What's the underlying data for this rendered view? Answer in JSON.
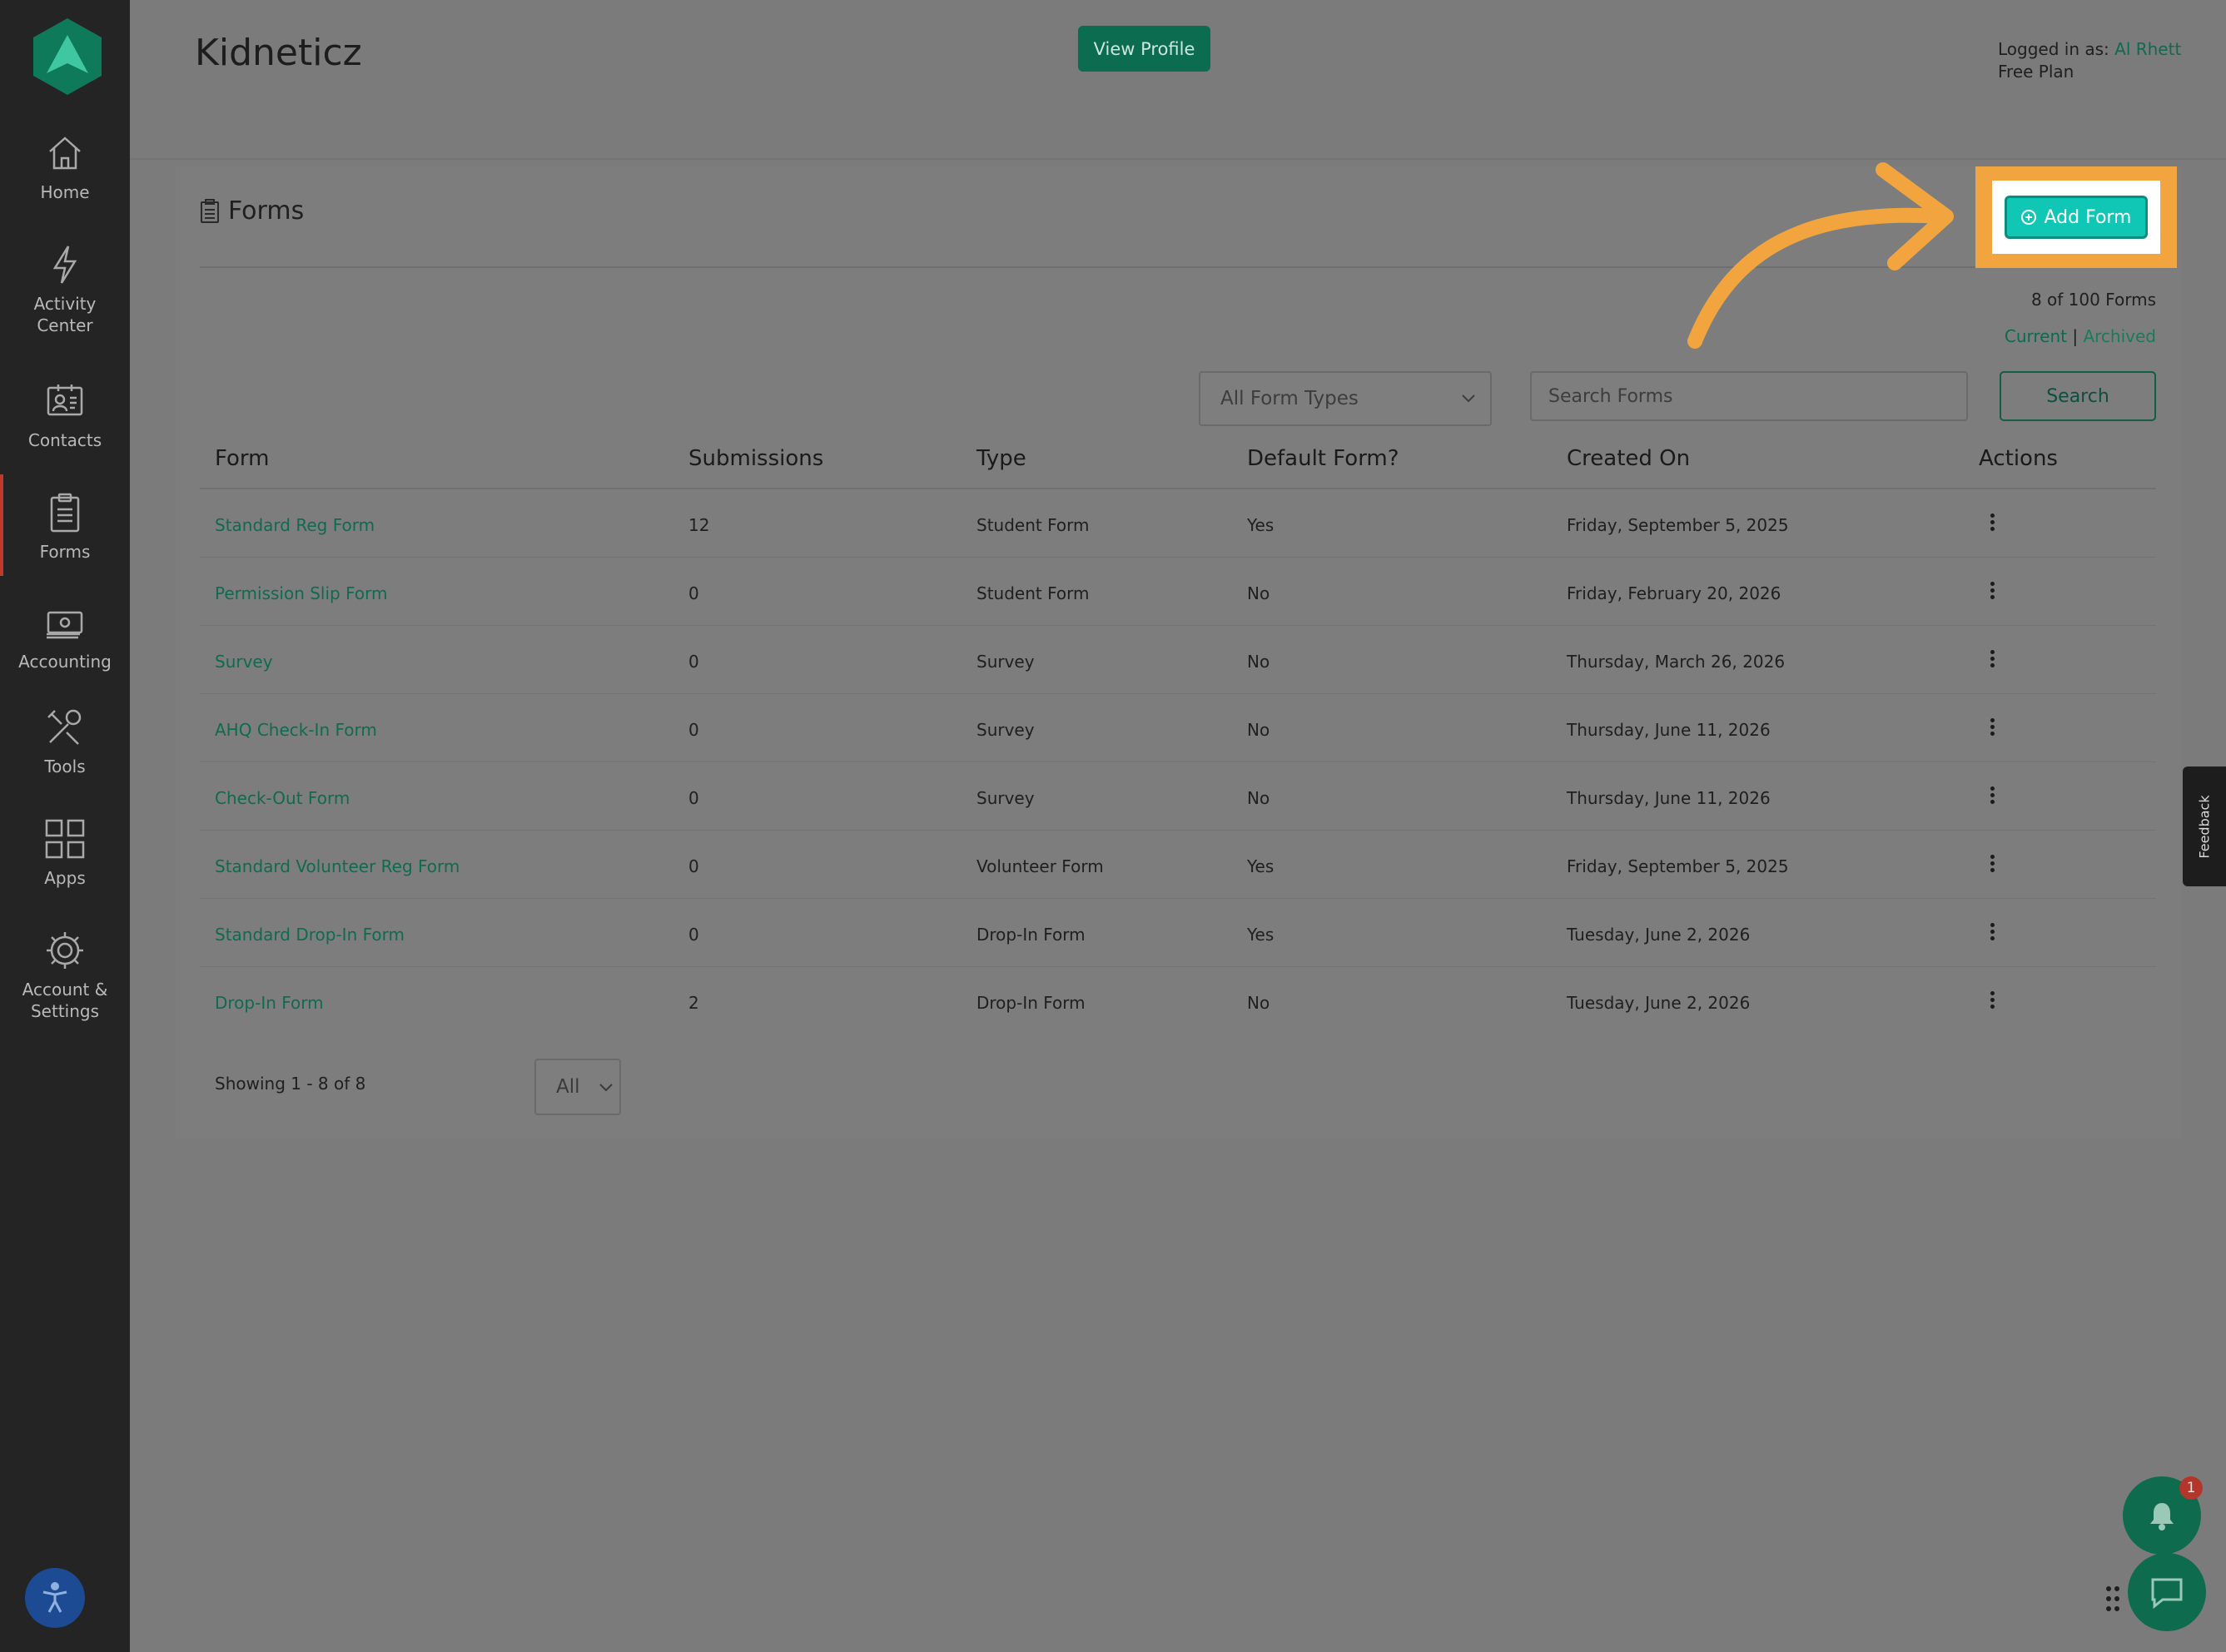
{
  "app": {
    "title": "Kidneticz",
    "view_profile_label": "View Profile",
    "logged_in_prefix": "Logged in as:",
    "user_name": "Al Rhett",
    "plan": "Free Plan"
  },
  "sidebar": {
    "items": [
      {
        "label": "Home",
        "icon": "home-icon"
      },
      {
        "label": "Activity\nCenter",
        "icon": "lightning-icon"
      },
      {
        "label": "Contacts",
        "icon": "contacts-icon"
      },
      {
        "label": "Forms",
        "icon": "clipboard-icon",
        "active": true
      },
      {
        "label": "Accounting",
        "icon": "money-icon"
      },
      {
        "label": "Tools",
        "icon": "tools-icon"
      },
      {
        "label": "Apps",
        "icon": "apps-grid-icon"
      },
      {
        "label": "Account &\nSettings",
        "icon": "gear-icon"
      }
    ]
  },
  "forms_panel": {
    "title": "Forms",
    "add_form_label": "Add Form",
    "count_label": "8 of 100 Forms",
    "filter_current": "Current",
    "filter_separator": " | ",
    "filter_archived": "Archived",
    "type_select_value": "All Form Types",
    "search_placeholder": "Search Forms",
    "search_button_label": "Search",
    "columns": [
      "Form",
      "Submissions",
      "Type",
      "Default Form?",
      "Created On",
      "Actions"
    ],
    "rows": [
      {
        "form": "Standard Reg Form",
        "submissions": "12",
        "type": "Student Form",
        "default": "Yes",
        "created": "Friday, September 5, 2025"
      },
      {
        "form": "Permission Slip Form",
        "submissions": "0",
        "type": "Student Form",
        "default": "No",
        "created": "Friday, February 20, 2026"
      },
      {
        "form": "Survey",
        "submissions": "0",
        "type": "Survey",
        "default": "No",
        "created": "Thursday, March 26, 2026"
      },
      {
        "form": "AHQ Check-In Form",
        "submissions": "0",
        "type": "Survey",
        "default": "No",
        "created": "Thursday, June 11, 2026"
      },
      {
        "form": "Check-Out Form",
        "submissions": "0",
        "type": "Survey",
        "default": "No",
        "created": "Thursday, June 11, 2026"
      },
      {
        "form": "Standard Volunteer Reg Form",
        "submissions": "0",
        "type": "Volunteer Form",
        "default": "Yes",
        "created": "Friday, September 5, 2025"
      },
      {
        "form": "Standard Drop-In Form",
        "submissions": "0",
        "type": "Drop-In Form",
        "default": "Yes",
        "created": "Tuesday, June 2, 2026"
      },
      {
        "form": "Drop-In Form",
        "submissions": "2",
        "type": "Drop-In Form",
        "default": "No",
        "created": "Tuesday, June 2, 2026"
      }
    ],
    "showing_label": "Showing 1 - 8 of 8",
    "page_size_value": "All"
  },
  "widgets": {
    "feedback_label": "Feedback",
    "notification_count": "1"
  },
  "colors": {
    "brand_green": "#0e6b4e",
    "highlight_orange": "#f2a53e",
    "add_button_teal": "#10c7b5"
  }
}
